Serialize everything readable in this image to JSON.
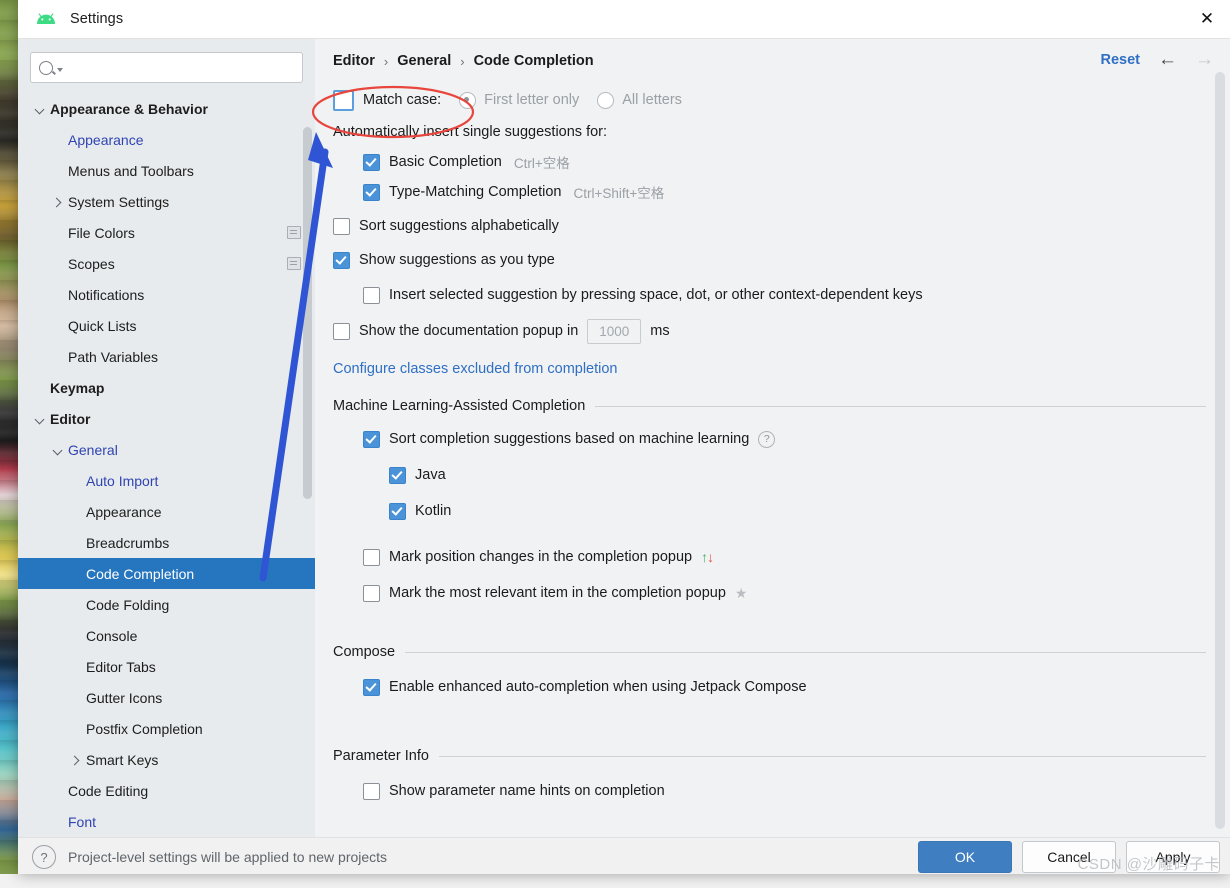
{
  "window": {
    "title": "Settings",
    "logo_icon": "android-logo-icon",
    "close_icon": "close-icon"
  },
  "search": {
    "value": "",
    "placeholder": "",
    "icon": "search-icon"
  },
  "sidebar": {
    "items": [
      {
        "label": "Appearance & Behavior",
        "indent": 0,
        "chevron": "down",
        "style": "bold",
        "badge": false,
        "selected": false
      },
      {
        "label": "Appearance",
        "indent": 1,
        "chevron": "none",
        "style": "link",
        "badge": false,
        "selected": false
      },
      {
        "label": "Menus and Toolbars",
        "indent": 1,
        "chevron": "none",
        "style": "plain",
        "badge": false,
        "selected": false
      },
      {
        "label": "System Settings",
        "indent": 1,
        "chevron": "right",
        "style": "plain",
        "badge": false,
        "selected": false
      },
      {
        "label": "File Colors",
        "indent": 1,
        "chevron": "none",
        "style": "plain",
        "badge": true,
        "selected": false
      },
      {
        "label": "Scopes",
        "indent": 1,
        "chevron": "none",
        "style": "plain",
        "badge": true,
        "selected": false
      },
      {
        "label": "Notifications",
        "indent": 1,
        "chevron": "none",
        "style": "plain",
        "badge": false,
        "selected": false
      },
      {
        "label": "Quick Lists",
        "indent": 1,
        "chevron": "none",
        "style": "plain",
        "badge": false,
        "selected": false
      },
      {
        "label": "Path Variables",
        "indent": 1,
        "chevron": "none",
        "style": "plain",
        "badge": false,
        "selected": false
      },
      {
        "label": "Keymap",
        "indent": 0,
        "chevron": "none",
        "style": "bold",
        "badge": false,
        "selected": false
      },
      {
        "label": "Editor",
        "indent": 0,
        "chevron": "down",
        "style": "bold",
        "badge": false,
        "selected": false
      },
      {
        "label": "General",
        "indent": 1,
        "chevron": "down",
        "style": "link",
        "badge": false,
        "selected": false
      },
      {
        "label": "Auto Import",
        "indent": 2,
        "chevron": "none",
        "style": "link",
        "badge": false,
        "selected": false
      },
      {
        "label": "Appearance",
        "indent": 2,
        "chevron": "none",
        "style": "plain",
        "badge": false,
        "selected": false
      },
      {
        "label": "Breadcrumbs",
        "indent": 2,
        "chevron": "none",
        "style": "plain",
        "badge": false,
        "selected": false
      },
      {
        "label": "Code Completion",
        "indent": 2,
        "chevron": "none",
        "style": "plain",
        "badge": false,
        "selected": true
      },
      {
        "label": "Code Folding",
        "indent": 2,
        "chevron": "none",
        "style": "plain",
        "badge": false,
        "selected": false
      },
      {
        "label": "Console",
        "indent": 2,
        "chevron": "none",
        "style": "plain",
        "badge": false,
        "selected": false
      },
      {
        "label": "Editor Tabs",
        "indent": 2,
        "chevron": "none",
        "style": "plain",
        "badge": false,
        "selected": false
      },
      {
        "label": "Gutter Icons",
        "indent": 2,
        "chevron": "none",
        "style": "plain",
        "badge": false,
        "selected": false
      },
      {
        "label": "Postfix Completion",
        "indent": 2,
        "chevron": "none",
        "style": "plain",
        "badge": false,
        "selected": false
      },
      {
        "label": "Smart Keys",
        "indent": 2,
        "chevron": "right",
        "style": "plain",
        "badge": false,
        "selected": false
      },
      {
        "label": "Code Editing",
        "indent": 1,
        "chevron": "none",
        "style": "plain",
        "badge": false,
        "selected": false
      },
      {
        "label": "Font",
        "indent": 1,
        "chevron": "none",
        "style": "link",
        "badge": false,
        "selected": false
      }
    ]
  },
  "breadcrumb": {
    "parts": [
      "Editor",
      "General",
      "Code Completion"
    ],
    "separator": "›"
  },
  "toolbar": {
    "reset_label": "Reset",
    "back_icon": "arrow-left-icon",
    "forward_icon": "arrow-right-icon",
    "back_arrow": "←",
    "forward_arrow": "→"
  },
  "main": {
    "match_case": {
      "label": "Match case:",
      "checked": false,
      "options": [
        {
          "label": "First letter only",
          "selected": true,
          "disabled": true
        },
        {
          "label": "All letters",
          "selected": false,
          "disabled": true
        }
      ]
    },
    "auto_insert_label": "Automatically insert single suggestions for:",
    "auto_insert_items": [
      {
        "label": "Basic Completion",
        "checked": true,
        "shortcut": "Ctrl+空格"
      },
      {
        "label": "Type-Matching Completion",
        "checked": true,
        "shortcut": "Ctrl+Shift+空格"
      }
    ],
    "sort_alpha": {
      "label": "Sort suggestions alphabetically",
      "checked": false
    },
    "show_as_type": {
      "label": "Show suggestions as you type",
      "checked": true
    },
    "insert_selected": {
      "label": "Insert selected suggestion by pressing space, dot, or other context-dependent keys",
      "checked": false
    },
    "doc_popup": {
      "label_before": "Show the documentation popup in",
      "value": "1000",
      "label_after": "ms",
      "checked": false
    },
    "configure_link": "Configure classes excluded from completion",
    "ml_group": {
      "title": "Machine Learning-Assisted Completion",
      "sort_ml": {
        "label": "Sort completion suggestions based on machine learning",
        "checked": true,
        "help_icon": "question-mark-icon"
      },
      "languages": [
        {
          "label": "Java",
          "checked": true
        },
        {
          "label": "Kotlin",
          "checked": true
        }
      ],
      "mark_position": {
        "label": "Mark position changes in the completion popup",
        "checked": false,
        "icon": "up-down-arrows-icon",
        "glyph": "↑↓"
      },
      "mark_relevant": {
        "label": "Mark the most relevant item in the completion popup",
        "checked": false,
        "icon": "star-icon",
        "glyph": "★"
      }
    },
    "compose_group": {
      "title": "Compose",
      "enable": {
        "label": "Enable enhanced auto-completion when using Jetpack Compose",
        "checked": true
      }
    },
    "param_group": {
      "title": "Parameter Info",
      "hints": {
        "label": "Show parameter name hints on completion",
        "checked": false
      }
    }
  },
  "footer": {
    "help_icon": "question-mark-icon",
    "help_glyph": "?",
    "message": "Project-level settings will be applied to new projects",
    "buttons": [
      {
        "label": "OK",
        "primary": true
      },
      {
        "label": "Cancel",
        "primary": false
      },
      {
        "label": "Apply",
        "primary": false
      }
    ]
  },
  "watermark": {
    "text": "CSDN @沙雕码子卡"
  },
  "annotations": {
    "ellipse_color": "#e8453c",
    "arrow_color": "#2f55d4"
  }
}
